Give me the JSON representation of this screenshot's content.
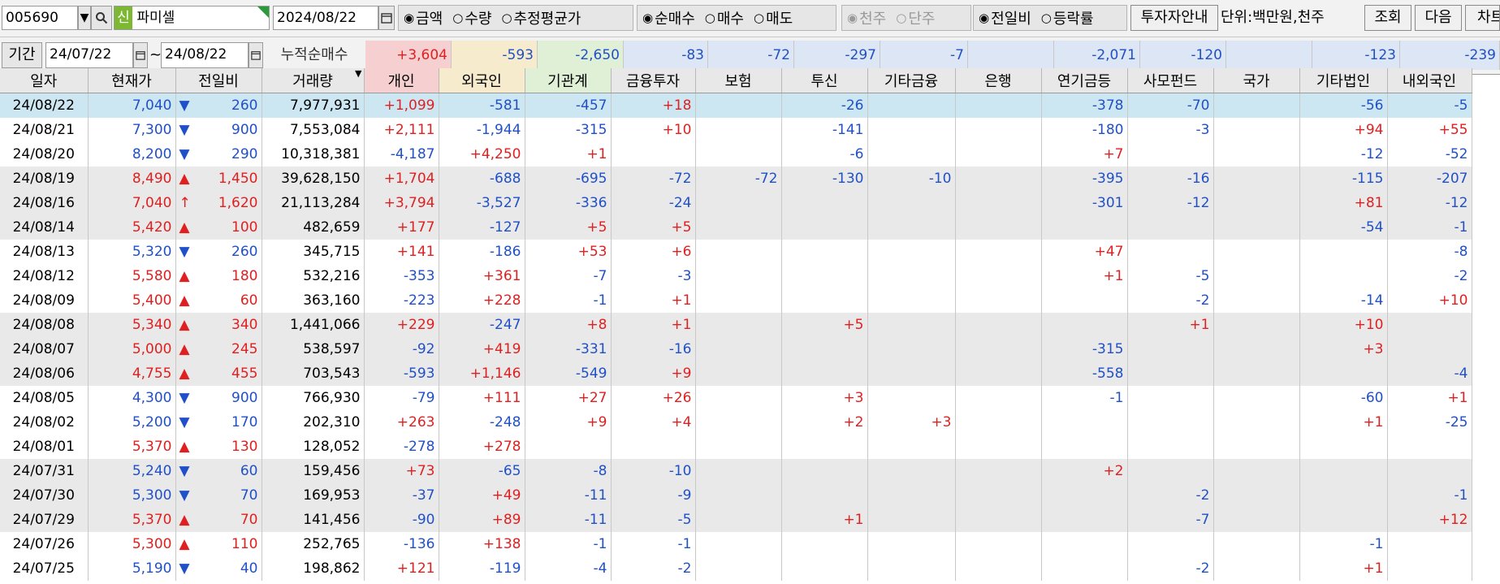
{
  "toolbar": {
    "code": "005690",
    "badge": "신",
    "name": "파미셀",
    "date": "2024/08/22",
    "type_opts": [
      "금액",
      "수량",
      "추정평균가"
    ],
    "mode_opts": [
      "순매수",
      "매수",
      "매도"
    ],
    "unit_opts": [
      "천주",
      "단주"
    ],
    "cmp_opts": [
      "전일비",
      "등락률"
    ],
    "guide_btn": "투자자안내",
    "unit_label": "단위:백만원,천주",
    "btn_query": "조회",
    "btn_next": "다음",
    "btn_chart": "차트"
  },
  "period": {
    "label": "기간",
    "from": "24/07/22",
    "tilde": "~",
    "to": "24/08/22",
    "sum_label": "누적순매수"
  },
  "sums": [
    "+3,604",
    "-593",
    "-2,650",
    "-83",
    "-72",
    "-297",
    "-7",
    "",
    "-2,071",
    "-120",
    "",
    "-123",
    "-239"
  ],
  "headers": [
    "일자",
    "현재가",
    "전일비",
    "거래량",
    "개인",
    "외국인",
    "기관계",
    "금융투자",
    "보험",
    "투신",
    "기타금융",
    "은행",
    "연기금등",
    "사모펀드",
    "국가",
    "기타법인",
    "내외국인"
  ],
  "colors": {
    "positive": "#e02020",
    "negative": "#2050c8",
    "selected_row": "#cde7f2",
    "grey_row": "#e9e9e9",
    "header_individual": "#f6d0d0",
    "header_foreign": "#f6ebcc",
    "header_inst": "#dff0d6",
    "badge_bg": "#7cb832"
  },
  "rows": [
    {
      "date": "24/08/22",
      "price": "7,040",
      "arrow": "▼",
      "chg": "260",
      "vol": "7,977,931",
      "v": [
        "+1,099",
        "-581",
        "-457",
        "+18",
        "",
        "-26",
        "",
        "",
        "-378",
        "-70",
        "",
        "-56",
        "-5"
      ]
    },
    {
      "date": "24/08/21",
      "price": "7,300",
      "arrow": "▼",
      "chg": "900",
      "vol": "7,553,084",
      "v": [
        "+2,111",
        "-1,944",
        "-315",
        "+10",
        "",
        "-141",
        "",
        "",
        "-180",
        "-3",
        "",
        "+94",
        "+55"
      ]
    },
    {
      "date": "24/08/20",
      "price": "8,200",
      "arrow": "▼",
      "chg": "290",
      "vol": "10,318,381",
      "v": [
        "-4,187",
        "+4,250",
        "+1",
        "",
        "",
        "-6",
        "",
        "",
        "+7",
        "",
        "",
        "-12",
        "-52"
      ]
    },
    {
      "date": "24/08/19",
      "price": "8,490",
      "arrow": "▲",
      "chg": "1,450",
      "vol": "39,628,150",
      "v": [
        "+1,704",
        "-688",
        "-695",
        "-72",
        "-72",
        "-130",
        "-10",
        "",
        "-395",
        "-16",
        "",
        "-115",
        "-207"
      ]
    },
    {
      "date": "24/08/16",
      "price": "7,040",
      "arrow": "↑",
      "chg": "1,620",
      "vol": "21,113,284",
      "v": [
        "+3,794",
        "-3,527",
        "-336",
        "-24",
        "",
        "",
        "",
        "",
        "-301",
        "-12",
        "",
        "+81",
        "-12"
      ]
    },
    {
      "date": "24/08/14",
      "price": "5,420",
      "arrow": "▲",
      "chg": "100",
      "vol": "482,659",
      "v": [
        "+177",
        "-127",
        "+5",
        "+5",
        "",
        "",
        "",
        "",
        "",
        "",
        "",
        "-54",
        "-1"
      ]
    },
    {
      "date": "24/08/13",
      "price": "5,320",
      "arrow": "▼",
      "chg": "260",
      "vol": "345,715",
      "v": [
        "+141",
        "-186",
        "+53",
        "+6",
        "",
        "",
        "",
        "",
        "+47",
        "",
        "",
        "",
        "-8"
      ]
    },
    {
      "date": "24/08/12",
      "price": "5,580",
      "arrow": "▲",
      "chg": "180",
      "vol": "532,216",
      "v": [
        "-353",
        "+361",
        "-7",
        "-3",
        "",
        "",
        "",
        "",
        "+1",
        "-5",
        "",
        "",
        "-2"
      ]
    },
    {
      "date": "24/08/09",
      "price": "5,400",
      "arrow": "▲",
      "chg": "60",
      "vol": "363,160",
      "v": [
        "-223",
        "+228",
        "-1",
        "+1",
        "",
        "",
        "",
        "",
        "",
        "-2",
        "",
        "-14",
        "+10"
      ]
    },
    {
      "date": "24/08/08",
      "price": "5,340",
      "arrow": "▲",
      "chg": "340",
      "vol": "1,441,066",
      "v": [
        "+229",
        "-247",
        "+8",
        "+1",
        "",
        "+5",
        "",
        "",
        "",
        "+1",
        "",
        "+10",
        ""
      ]
    },
    {
      "date": "24/08/07",
      "price": "5,000",
      "arrow": "▲",
      "chg": "245",
      "vol": "538,597",
      "v": [
        "-92",
        "+419",
        "-331",
        "-16",
        "",
        "",
        "",
        "",
        "-315",
        "",
        "",
        "+3",
        ""
      ]
    },
    {
      "date": "24/08/06",
      "price": "4,755",
      "arrow": "▲",
      "chg": "455",
      "vol": "703,543",
      "v": [
        "-593",
        "+1,146",
        "-549",
        "+9",
        "",
        "",
        "",
        "",
        "-558",
        "",
        "",
        "",
        "-4"
      ]
    },
    {
      "date": "24/08/05",
      "price": "4,300",
      "arrow": "▼",
      "chg": "900",
      "vol": "766,930",
      "v": [
        "-79",
        "+111",
        "+27",
        "+26",
        "",
        "+3",
        "",
        "",
        "-1",
        "",
        "",
        "-60",
        "+1"
      ]
    },
    {
      "date": "24/08/02",
      "price": "5,200",
      "arrow": "▼",
      "chg": "170",
      "vol": "202,310",
      "v": [
        "+263",
        "-248",
        "+9",
        "+4",
        "",
        "+2",
        "+3",
        "",
        "",
        "",
        "",
        "+1",
        "-25"
      ]
    },
    {
      "date": "24/08/01",
      "price": "5,370",
      "arrow": "▲",
      "chg": "130",
      "vol": "128,052",
      "v": [
        "-278",
        "+278",
        "",
        "",
        "",
        "",
        "",
        "",
        "",
        "",
        "",
        "",
        ""
      ]
    },
    {
      "date": "24/07/31",
      "price": "5,240",
      "arrow": "▼",
      "chg": "60",
      "vol": "159,456",
      "v": [
        "+73",
        "-65",
        "-8",
        "-10",
        "",
        "",
        "",
        "",
        "+2",
        "",
        "",
        "",
        ""
      ]
    },
    {
      "date": "24/07/30",
      "price": "5,300",
      "arrow": "▼",
      "chg": "70",
      "vol": "169,953",
      "v": [
        "-37",
        "+49",
        "-11",
        "-9",
        "",
        "",
        "",
        "",
        "",
        "-2",
        "",
        "",
        "-1"
      ]
    },
    {
      "date": "24/07/29",
      "price": "5,370",
      "arrow": "▲",
      "chg": "70",
      "vol": "141,456",
      "v": [
        "-90",
        "+89",
        "-11",
        "-5",
        "",
        "+1",
        "",
        "",
        "",
        "-7",
        "",
        "",
        "+12"
      ]
    },
    {
      "date": "24/07/26",
      "price": "5,300",
      "arrow": "▲",
      "chg": "110",
      "vol": "252,765",
      "v": [
        "-136",
        "+138",
        "-1",
        "-1",
        "",
        "",
        "",
        "",
        "",
        "",
        "",
        "-1",
        ""
      ]
    },
    {
      "date": "24/07/25",
      "price": "5,190",
      "arrow": "▼",
      "chg": "40",
      "vol": "198,862",
      "v": [
        "+121",
        "-119",
        "-4",
        "-2",
        "",
        "",
        "",
        "",
        "",
        "-2",
        "",
        "+1",
        ""
      ]
    }
  ]
}
